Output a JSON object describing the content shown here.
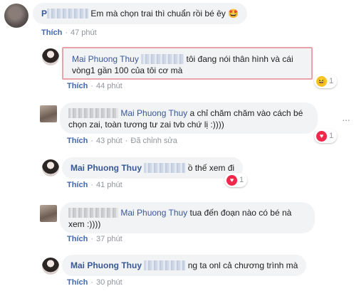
{
  "comments": [
    {
      "id": "c1",
      "author_visible": "P",
      "text": "Em mà chọn trai thì chuẩn rồi bé êy",
      "emoji": "🤩",
      "like": "Thích",
      "time": "47 phút"
    },
    {
      "id": "c2",
      "tag": "Mai Phuong Thuy",
      "text": "tôi đang nói thân hình và cái vòng1 gần 100 của tôi cơ mà",
      "like": "Thích",
      "time": "44 phút",
      "reaction_count": "1",
      "reaction": "haha"
    },
    {
      "id": "c3",
      "tag": "Mai Phuong Thuy",
      "text": "a chỉ chăm chăm vào cách bé chọn zai, toàn tương tư zai tvb chứ lị :))))",
      "like": "Thích",
      "time": "43 phút",
      "edited": "Đã chỉnh sửa",
      "reaction_count": "1",
      "reaction": "love",
      "more": "···"
    },
    {
      "id": "c4",
      "author": "Mai Phuong Thuy",
      "text": "ồ thế xem đi",
      "like": "Thích",
      "time": "41 phút",
      "reaction_count": "1",
      "reaction": "love"
    },
    {
      "id": "c5",
      "tag": "Mai Phuong Thuy",
      "text": "tua đến đoạn nào có bé nà xem :))))",
      "like": "Thích",
      "time": "37 phút"
    },
    {
      "id": "c6",
      "author": "Mai Phuong Thuy",
      "text": "ng ta onl cả chương trình mà",
      "like": "Thích",
      "time": "30 phút"
    }
  ],
  "colors": {
    "link": "#385898",
    "meta": "#90949c",
    "bubble": "#f2f3f5",
    "highlight_border": "#e8a3aa"
  }
}
